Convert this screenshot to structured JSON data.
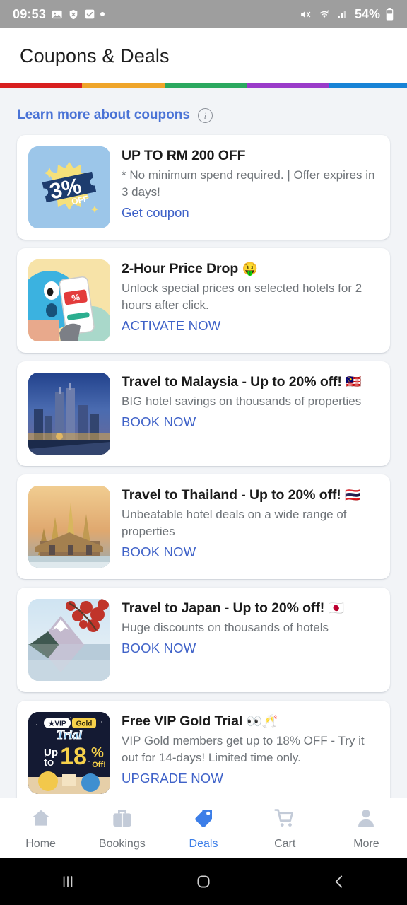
{
  "statusbar": {
    "clock": "09:53",
    "icons_left": [
      "image-icon",
      "shield-x-icon",
      "checkbox-icon",
      "dot-icon"
    ],
    "icons_right": [
      "mute-icon",
      "wifi-6-icon",
      "signal-icon"
    ],
    "battery_percent": "54%",
    "battery_icon": "battery-icon",
    "background_color": "#9E9E9E"
  },
  "appbar": {
    "title": "Coupons & Deals"
  },
  "stripe": {
    "colors": [
      "#D81F1F",
      "#EFA52A",
      "#2BA85F",
      "#9A3BC9",
      "#1783D6"
    ],
    "widths": [
      116,
      117,
      117,
      115,
      111
    ]
  },
  "learn_more": {
    "label": "Learn more about coupons",
    "info_icon": "info-icon",
    "link_color": "#4A73D6"
  },
  "cards": [
    {
      "thumb_name": "coupon-3-percent-thumbnail",
      "thumb_kind": "coupon",
      "thumb_text_main": "3%",
      "thumb_text_sub": "OFF",
      "title": "UP TO RM 200 OFF",
      "emoji": "",
      "desc": "* No minimum spend required. | Offer expires in 3 days!",
      "link": "Get coupon"
    },
    {
      "thumb_name": "price-drop-illustration-thumbnail",
      "thumb_kind": "pricedrop",
      "thumb_text_main": "",
      "thumb_text_sub": "",
      "title": "2-Hour Price Drop",
      "emoji": "🤑",
      "desc": "Unlock special prices on selected hotels for 2 hours after click.",
      "link": "ACTIVATE NOW"
    },
    {
      "thumb_name": "malaysia-skyline-thumbnail",
      "thumb_kind": "kl",
      "thumb_text_main": "",
      "thumb_text_sub": "",
      "title": "Travel to Malaysia - Up to 20% off!",
      "emoji": "🇲🇾",
      "desc": "BIG hotel savings on thousands of properties",
      "link": "BOOK NOW"
    },
    {
      "thumb_name": "thailand-temple-thumbnail",
      "thumb_kind": "th",
      "thumb_text_main": "",
      "thumb_text_sub": "",
      "title": "Travel to Thailand - Up to 20% off!",
      "emoji": "🇹🇭",
      "desc": "Unbeatable hotel deals on a wide range of properties",
      "link": "BOOK NOW"
    },
    {
      "thumb_name": "japan-mount-fuji-thumbnail",
      "thumb_kind": "jp",
      "thumb_text_main": "",
      "thumb_text_sub": "",
      "title": "Travel to Japan - Up to 20% off!",
      "emoji": "🇯🇵",
      "desc": "Huge discounts on thousands of hotels",
      "link": "BOOK NOW"
    },
    {
      "thumb_name": "vip-gold-trial-thumbnail",
      "thumb_kind": "vip",
      "thumb_text_main": "18",
      "thumb_text_sub": "Off!",
      "thumb_badge_vip": "★VIP",
      "thumb_badge_gold": "Gold",
      "thumb_badge_trial": "Trial",
      "thumb_upto": "Up to",
      "title": "Free VIP Gold Trial",
      "emoji": "👀🥂",
      "desc": "VIP Gold members get up to 18% OFF - Try it out for 14-days! Limited time only.",
      "link": "UPGRADE NOW"
    }
  ],
  "bottom_nav": {
    "active_color": "#3C7EE8",
    "inactive_color": "#C3CBD8",
    "items": [
      {
        "label": "Home",
        "icon": "home-icon",
        "active": false
      },
      {
        "label": "Bookings",
        "icon": "briefcase-icon",
        "active": false
      },
      {
        "label": "Deals",
        "icon": "tag-icon",
        "active": true
      },
      {
        "label": "Cart",
        "icon": "cart-icon",
        "active": false
      },
      {
        "label": "More",
        "icon": "person-icon",
        "active": false
      }
    ]
  },
  "android_nav": {
    "recents_icon": "recents-icon",
    "home_icon": "home-circle-icon",
    "back_icon": "back-chevron-icon"
  }
}
